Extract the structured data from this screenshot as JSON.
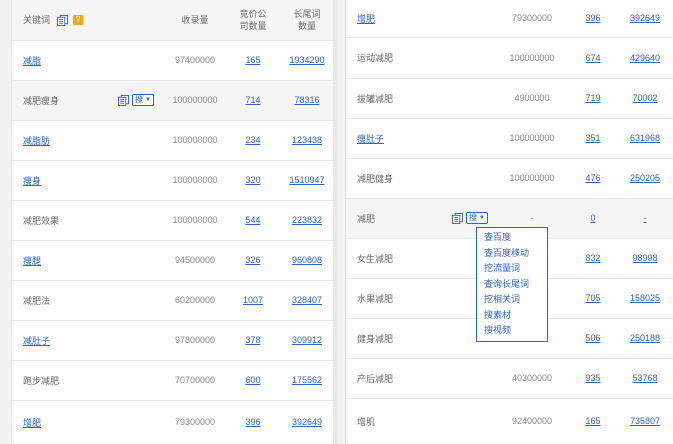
{
  "header": {
    "keyword": "关键词",
    "search_volume": "收录量",
    "competitors_line1": "竞价公",
    "competitors_line2": "司数量",
    "longtail_line1": "长尾词",
    "longtail_line2": "数量"
  },
  "left_rows": [
    {
      "keyword": "减脂",
      "volume": "97400000",
      "companies": "165",
      "longtail": "1934290",
      "linked": true
    },
    {
      "keyword": "减肥瘦身",
      "volume": "100000000",
      "companies": "714",
      "longtail": "78316",
      "linked": false
    },
    {
      "keyword": "减脂肪",
      "volume": "100000000",
      "companies": "234",
      "longtail": "123438",
      "linked": true
    },
    {
      "keyword": "瘦身",
      "volume": "100000000",
      "companies": "320",
      "longtail": "1510947",
      "linked": true
    },
    {
      "keyword": "减肥效果",
      "volume": "100000000",
      "companies": "544",
      "longtail": "223832",
      "linked": false
    },
    {
      "keyword": "瘦腿",
      "volume": "94500000",
      "companies": "326",
      "longtail": "960808",
      "linked": true
    },
    {
      "keyword": "减肥法",
      "volume": "60200000",
      "companies": "1007",
      "longtail": "328407",
      "linked": false
    },
    {
      "keyword": "减肚子",
      "volume": "97800000",
      "companies": "378",
      "longtail": "309912",
      "linked": true
    },
    {
      "keyword": "跑步减肥",
      "volume": "70700000",
      "companies": "600",
      "longtail": "175562",
      "linked": false
    },
    {
      "keyword": "增肥",
      "volume": "79300000",
      "companies": "396",
      "longtail": "392649",
      "linked": true
    }
  ],
  "right_rows": [
    {
      "keyword": "增肥",
      "volume": "79300000",
      "companies": "396",
      "longtail": "392649",
      "linked": true
    },
    {
      "keyword": "运动减肥",
      "volume": "100000000",
      "companies": "674",
      "longtail": "429640",
      "linked": false
    },
    {
      "keyword": "拔罐减肥",
      "volume": "4900000",
      "companies": "719",
      "longtail": "70002",
      "linked": false
    },
    {
      "keyword": "瘦肚子",
      "volume": "100000000",
      "companies": "351",
      "longtail": "631968",
      "linked": true
    },
    {
      "keyword": "减肥健身",
      "volume": "100000000",
      "companies": "476",
      "longtail": "250205",
      "linked": false
    },
    {
      "keyword": "减肥",
      "volume": "-",
      "companies": "0",
      "longtail": "-",
      "linked": false
    },
    {
      "keyword": "女生减肥",
      "volume": "",
      "companies": "832",
      "longtail": "98998",
      "linked": false
    },
    {
      "keyword": "水果减肥",
      "volume": "",
      "companies": "705",
      "longtail": "158025",
      "linked": false
    },
    {
      "keyword": "健身减肥",
      "volume": "",
      "companies": "506",
      "longtail": "250188",
      "linked": false
    },
    {
      "keyword": "产后减肥",
      "volume": "40300000",
      "companies": "935",
      "longtail": "53768",
      "linked": false
    },
    {
      "keyword": "增肌",
      "volume": "92400000",
      "companies": "165",
      "longtail": "735807",
      "linked": false
    }
  ],
  "search_button_label": "搜",
  "dropdown_items": [
    "查百度",
    "查百度移动",
    "挖流量词",
    "查询长尾词",
    "挖相关词",
    "搜素材",
    "搜视频"
  ]
}
